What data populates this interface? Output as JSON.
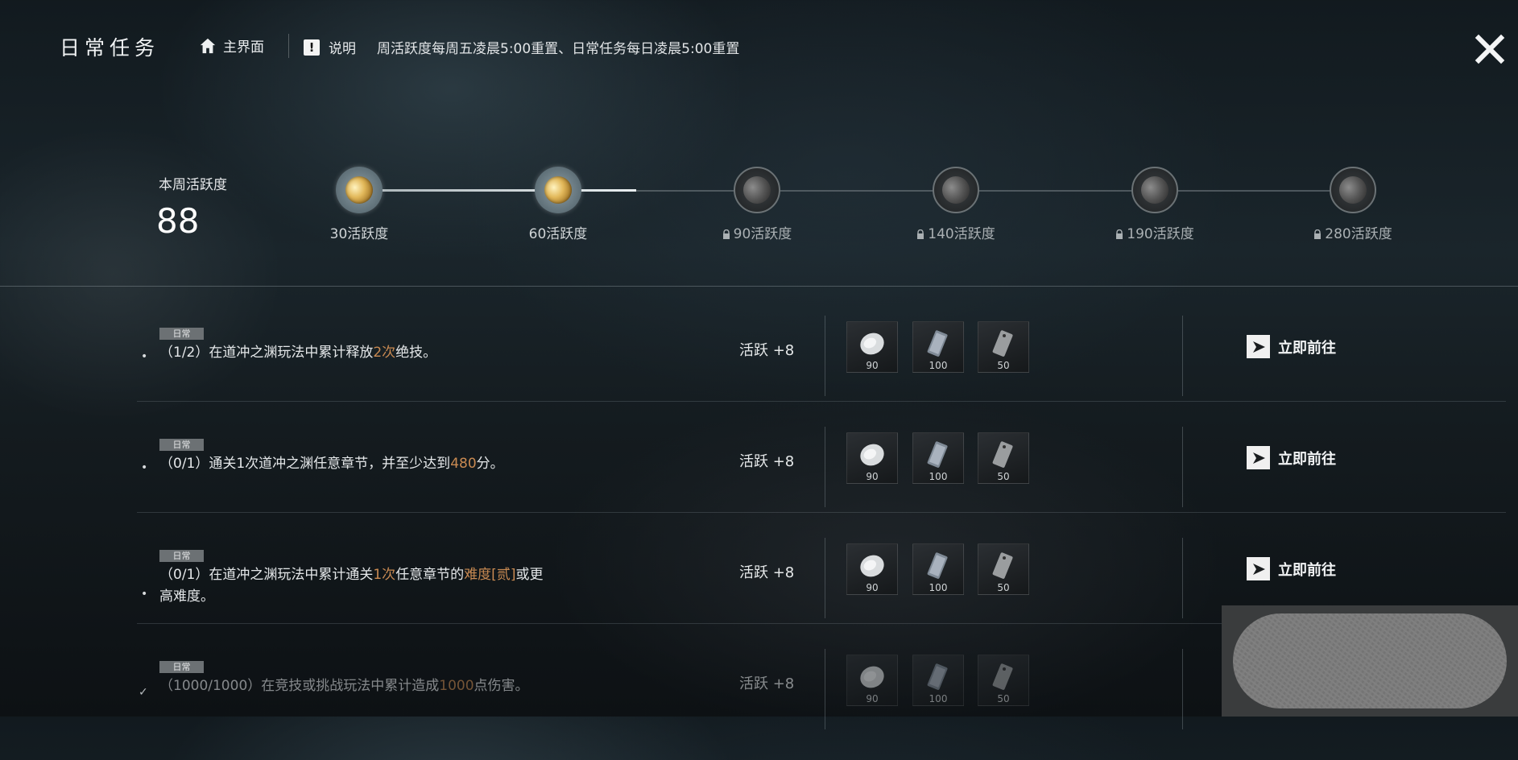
{
  "header": {
    "title": "日常任务",
    "home_label": "主界面",
    "info_label": "说明",
    "notice": "周活跃度每周五凌晨5:00重置、日常任务每日凌晨5:00重置"
  },
  "weekly": {
    "label": "本周活跃度",
    "value": "88",
    "progress_fraction": 0.275
  },
  "milestones": [
    {
      "label": "30活跃度",
      "locked": false
    },
    {
      "label": "60活跃度",
      "locked": false
    },
    {
      "label": "90活跃度",
      "locked": true
    },
    {
      "label": "140活跃度",
      "locked": true
    },
    {
      "label": "190活跃度",
      "locked": true
    },
    {
      "label": "280活跃度",
      "locked": true
    }
  ],
  "tasks": [
    {
      "tag": "日常",
      "prefix": "（1/2）在道冲之渊玩法中累计释放",
      "hl1": "2次",
      "mid": "绝技。",
      "hl2": "",
      "suffix": "",
      "line2": "",
      "activity": "活跃  +8",
      "rewards": [
        "90",
        "100",
        "50"
      ],
      "goto": "立即前往",
      "done": false
    },
    {
      "tag": "日常",
      "prefix": "（0/1）通关1次道冲之渊任意章节，并至少达到",
      "hl1": "480",
      "mid": "分。",
      "hl2": "",
      "suffix": "",
      "line2": "",
      "activity": "活跃  +8",
      "rewards": [
        "90",
        "100",
        "50"
      ],
      "goto": "立即前往",
      "done": false
    },
    {
      "tag": "日常",
      "prefix": "（0/1）在道冲之渊玩法中累计通关",
      "hl1": "1次",
      "mid": "任意章节的",
      "hl2": "难度[贰]",
      "suffix": "或更",
      "line2": "高难度。",
      "activity": "活跃  +8",
      "rewards": [
        "90",
        "100",
        "50"
      ],
      "goto": "立即前往",
      "done": false
    },
    {
      "tag": "日常",
      "prefix": "（1000/1000）在竞技或挑战玩法中累计造成",
      "hl1": "1000",
      "mid": "点伤害。",
      "hl2": "",
      "suffix": "",
      "line2": "",
      "activity": "活跃  +8",
      "rewards": [
        "90",
        "100",
        "50"
      ],
      "goto": "",
      "done": true
    }
  ],
  "colors": {
    "highlight": "#c98a52",
    "tag_bg": "#6c7174"
  }
}
